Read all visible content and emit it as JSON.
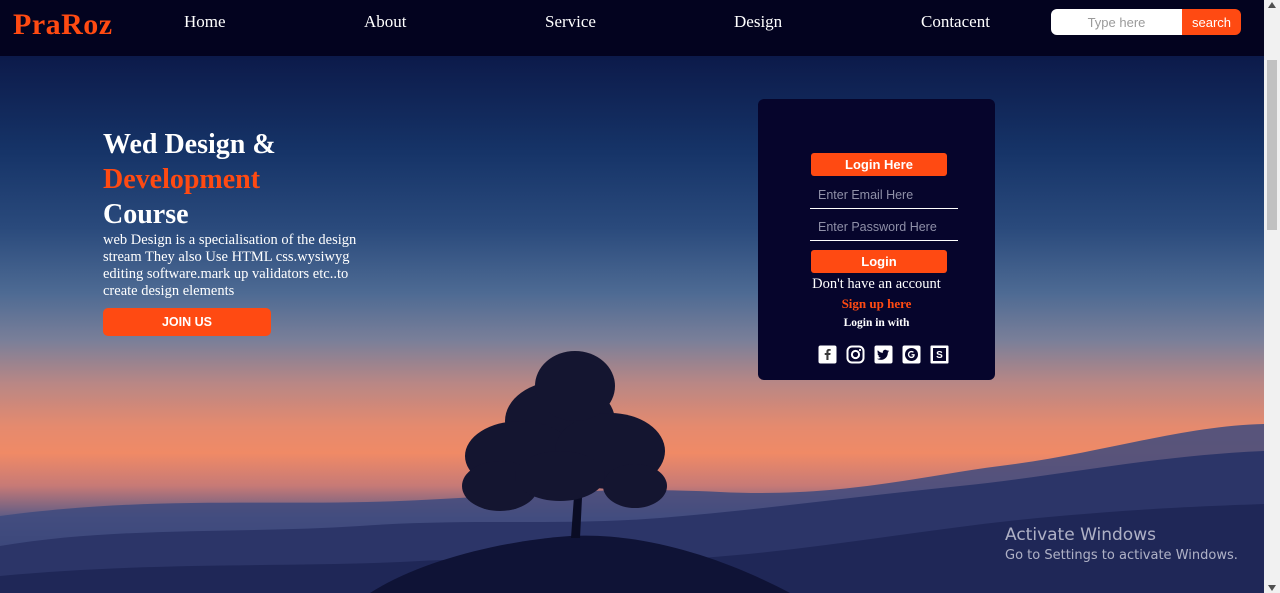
{
  "brand": {
    "logo": "PraRoz"
  },
  "nav": {
    "links": [
      {
        "label": "Home"
      },
      {
        "label": "About"
      },
      {
        "label": "Service"
      },
      {
        "label": "Design"
      },
      {
        "label": "Contacent"
      }
    ],
    "search": {
      "placeholder": "Type here",
      "value": "",
      "button_label": "search"
    }
  },
  "hero": {
    "title_line1": "Wed Design &",
    "title_line2": "Development",
    "title_line3": "Course",
    "description": "web Design is a specialisation of the design stream They also Use HTML css.wysiwyg editing software.mark up validators etc..to create design elements",
    "cta_label": "JOIN US"
  },
  "login": {
    "header": "Login Here",
    "email_placeholder": "Enter Email Here",
    "password_placeholder": "Enter Password Here",
    "submit_label": "Login",
    "no_account": "Don't have an account",
    "signup_label": "Sign up here",
    "login_with": "Login in with",
    "social": [
      "facebook-icon",
      "instagram-icon",
      "twitter-icon",
      "google-icon",
      "skype-icon"
    ]
  },
  "watermark": {
    "title": "Activate Windows",
    "subtitle": "Go to Settings to activate Windows."
  },
  "colors": {
    "accent": "#ff4a12",
    "navbar": "#03031f",
    "card": "#06052c"
  }
}
